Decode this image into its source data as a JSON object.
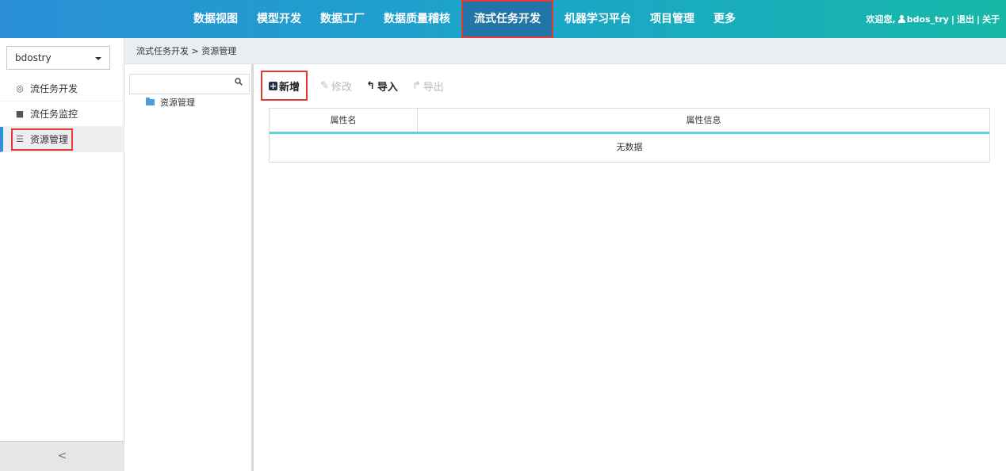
{
  "nav": {
    "items": [
      {
        "label": "数据视图"
      },
      {
        "label": "模型开发"
      },
      {
        "label": "数据工厂"
      },
      {
        "label": "数据质量稽核"
      },
      {
        "label": "流式任务开发",
        "active": true
      },
      {
        "label": "机器学习平台"
      },
      {
        "label": "项目管理"
      },
      {
        "label": "更多"
      }
    ],
    "welcome": "欢迎您,",
    "username": "bdos_try",
    "logout": "退出",
    "about": "关于",
    "separator": "|"
  },
  "sidebar": {
    "project": "bdostry",
    "items": [
      {
        "label": "流任务开发",
        "icon": "eye-icon"
      },
      {
        "label": "流任务监控",
        "icon": "monitor-icon"
      },
      {
        "label": "资源管理",
        "icon": "list-icon",
        "active": true
      }
    ],
    "collapse_glyph": "<"
  },
  "breadcrumb": {
    "text": "流式任务开发 > 资源管理"
  },
  "tree": {
    "search_placeholder": "",
    "node_label": "资源管理"
  },
  "toolbar": {
    "add": "新增",
    "edit": "修改",
    "import": "导入",
    "export": "导出"
  },
  "grid": {
    "columns": [
      "属性名",
      "属性信息"
    ],
    "empty_text": "无数据"
  },
  "colors": {
    "header_start": "#2a8fd6",
    "header_end": "#17b8a8",
    "active_nav_bg": "#2175a8",
    "highlight_red": "#e53935",
    "grid_accent": "#5fd3dd"
  }
}
